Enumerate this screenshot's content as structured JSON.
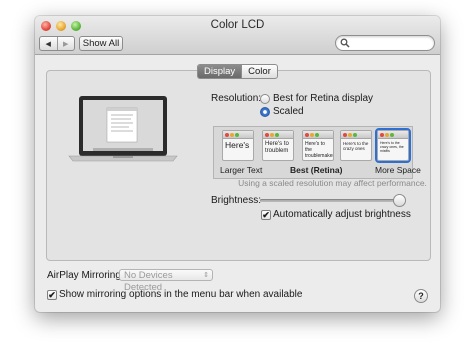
{
  "window": {
    "title": "Color LCD"
  },
  "toolbar": {
    "back_glyph": "◀",
    "forward_glyph": "▶",
    "show_all_label": "Show All",
    "search": {
      "value": "",
      "placeholder": ""
    }
  },
  "tabs": [
    {
      "label": "Display",
      "selected": true
    },
    {
      "label": "Color",
      "selected": false
    }
  ],
  "resolution": {
    "label": "Resolution:",
    "options": [
      {
        "label": "Best for Retina display",
        "selected": false
      },
      {
        "label": "Scaled",
        "selected": true
      }
    ],
    "scaled": {
      "preview_texts": [
        "Here's",
        "Here's to troublem",
        "Here's to the troublemakers",
        "Here's to the crazy ones",
        "Here's to the crazy ones, the misfits"
      ],
      "selected_index": 2,
      "labels": {
        "left": "Larger Text",
        "middle": "Best (Retina)",
        "right": "More Space"
      },
      "note": "Using a scaled resolution may affect performance."
    }
  },
  "brightness": {
    "label": "Brightness:",
    "level_fraction": 1.0
  },
  "auto_brightness": {
    "label": "Automatically adjust brightness",
    "checked": true
  },
  "airplay": {
    "label": "AirPlay Mirroring:",
    "value": "No Devices Detected",
    "arrow_glyph": "⇕"
  },
  "mirroring_option": {
    "label": "Show mirroring options in the menu bar when available",
    "checked": true
  },
  "help": {
    "glyph": "?"
  },
  "check_glyph": "✔",
  "colors": {
    "accent": "#3f7bd6",
    "close": "#e14b3d",
    "minimize": "#e7a834",
    "zoom": "#5cb83b"
  }
}
